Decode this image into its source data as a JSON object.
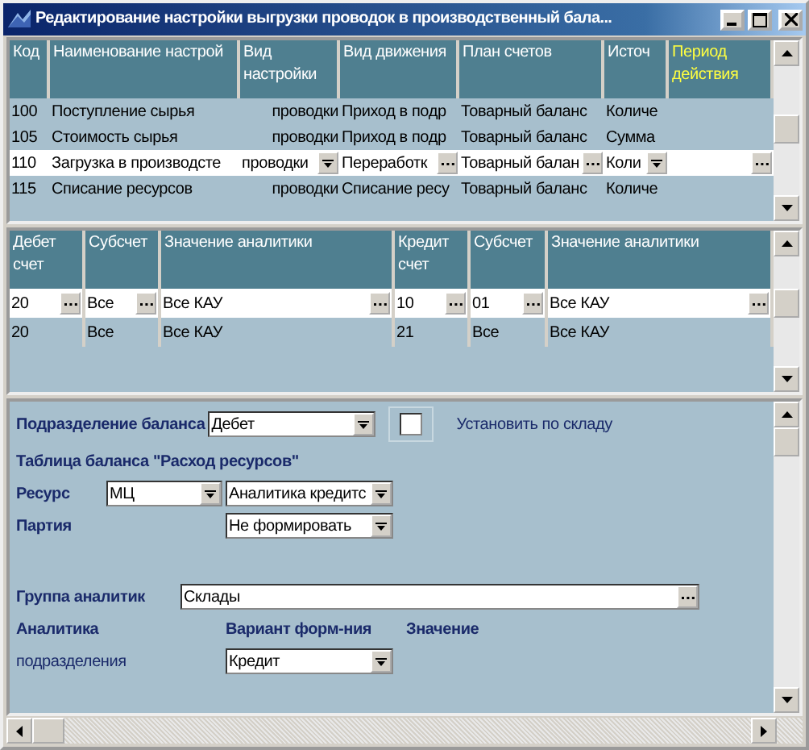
{
  "window": {
    "title": "Редактирование настройки выгрузки проводок в производственный бала..."
  },
  "settings_table": {
    "columns": [
      {
        "label": "Код",
        "kind": "text",
        "accent": false
      },
      {
        "label": "Наименование настрой",
        "kind": "text",
        "accent": false
      },
      {
        "label": "Вид настройки",
        "kind": "dropdown",
        "accent": false
      },
      {
        "label": "Вид движения",
        "kind": "browse",
        "accent": false
      },
      {
        "label": "План счетов",
        "kind": "browse",
        "accent": false
      },
      {
        "label": "Источ",
        "kind": "dropdown",
        "accent": false
      },
      {
        "label": "Период действия",
        "kind": "browse",
        "accent": true
      }
    ],
    "rows": [
      {
        "cells": [
          "100",
          "Поступление сырья",
          "проводки",
          "Приход в подр",
          "Товарный баланс",
          "Количе"
        ],
        "selected": false
      },
      {
        "cells": [
          "105",
          "Стоимость сырья",
          "проводки",
          "Приход в подр",
          "Товарный баланс",
          "Сумма"
        ],
        "selected": false
      },
      {
        "cells": [
          "110",
          "Загрузка в производсте",
          "проводки",
          "Переработк",
          "Товарный балан",
          "Коли"
        ],
        "selected": true
      },
      {
        "cells": [
          "115",
          "Списание ресурсов",
          "проводки",
          "Списание ресу",
          "Товарный баланс",
          "Количе"
        ],
        "selected": false
      }
    ]
  },
  "entries_table": {
    "columns": [
      {
        "label": "Дебет счет"
      },
      {
        "label": "Субсчет"
      },
      {
        "label": "Значение аналитики"
      },
      {
        "label": "Кредит счет"
      },
      {
        "label": "Субсчет"
      },
      {
        "label": "Значение аналитики"
      }
    ],
    "rows": [
      {
        "cells": [
          "20",
          "Все",
          "Все КАУ",
          "10",
          "01",
          "Все КАУ"
        ],
        "selected": true
      },
      {
        "cells": [
          "20",
          "Все",
          "Все КАУ",
          "21",
          "Все",
          "Все КАУ"
        ],
        "selected": false
      }
    ]
  },
  "form": {
    "subdivision": {
      "label": "Подразделение баланса",
      "value": "Дебет",
      "checked": false,
      "checkbox_label": "Установить по складу"
    },
    "table_title": "Таблица баланса \"Расход ресурсов\"",
    "resource": {
      "label": "Ресурс",
      "value": "МЦ",
      "analytics": "Аналитика кредитс"
    },
    "batch": {
      "label": "Партия",
      "value": "Не формировать"
    },
    "analytics_group": {
      "label": "Группа аналитик",
      "value": "Склады"
    },
    "analytics_headers": [
      "Аналитика",
      "Вариант форм-ния",
      "Значение"
    ],
    "analytics_rows": [
      {
        "name": "подразделения",
        "variant": "Кредит"
      }
    ]
  }
}
